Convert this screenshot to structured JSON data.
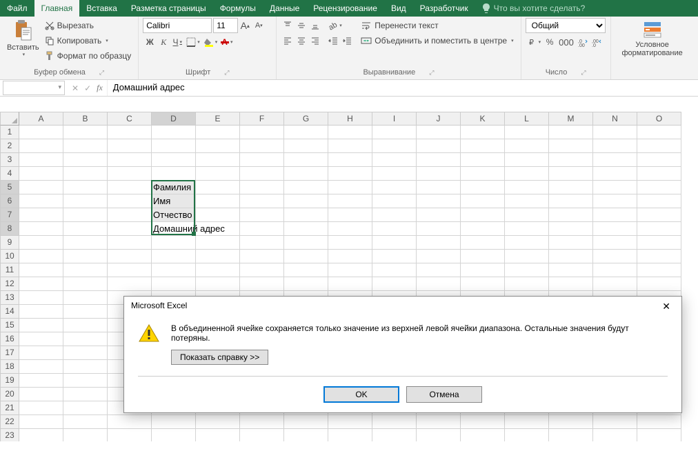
{
  "tabs": {
    "file": "Файл",
    "home": "Главная",
    "insert": "Вставка",
    "layout": "Разметка страницы",
    "formulas": "Формулы",
    "data": "Данные",
    "review": "Рецензирование",
    "view": "Вид",
    "developer": "Разработчик",
    "tellme": "Что вы хотите сделать?"
  },
  "ribbon": {
    "paste": "Вставить",
    "cut": "Вырезать",
    "copy": "Копировать",
    "format_painter": "Формат по образцу",
    "clipboard_label": "Буфер обмена",
    "font": "Calibri",
    "font_size": "11",
    "bold": "Ж",
    "italic": "К",
    "underline": "Ч",
    "font_label": "Шрифт",
    "alignment_label": "Выравнивание",
    "wrap": "Перенести текст",
    "merge": "Объединить и поместить в центре",
    "number_format": "Общий",
    "number_label": "Число",
    "cond_fmt": "Условное форматирование"
  },
  "formula_bar": {
    "value": "Домашний адрес",
    "fx": "fx"
  },
  "grid": {
    "cols": [
      "A",
      "B",
      "C",
      "D",
      "E",
      "F",
      "G",
      "H",
      "I",
      "J",
      "K",
      "L",
      "M",
      "N",
      "O"
    ],
    "rows_count": 23,
    "cells": {
      "D5": "Фамилия",
      "D6": "Имя",
      "D7": "Отчество",
      "D8": "Домашний адрес"
    }
  },
  "dialog": {
    "title": "Microsoft Excel",
    "message": "В объединенной ячейке сохраняется только значение из верхней левой ячейки диапазона. Остальные значения будут потеряны.",
    "show_help": "Показать справку >>",
    "ok": "OK",
    "cancel": "Отмена"
  },
  "colors": {
    "primary": "#217346"
  }
}
